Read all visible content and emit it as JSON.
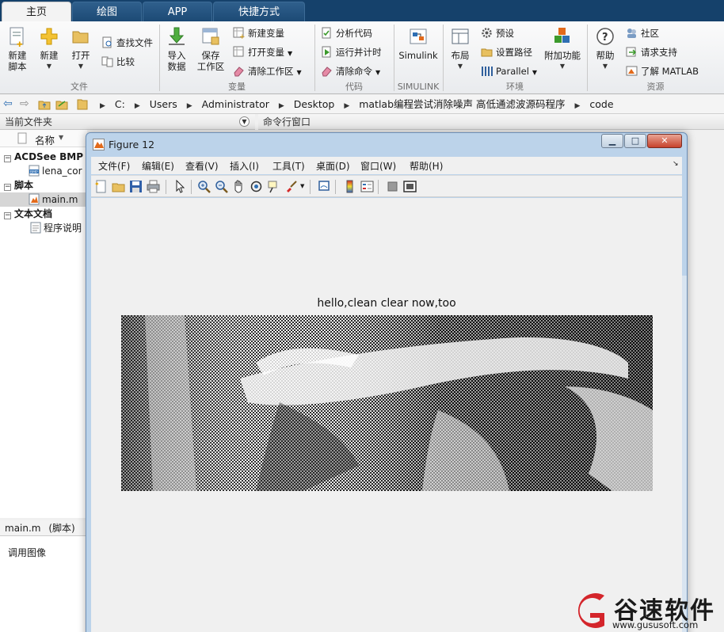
{
  "tabs": [
    {
      "label": "主页",
      "active": true
    },
    {
      "label": "绘图",
      "active": false
    },
    {
      "label": "APP",
      "active": false
    },
    {
      "label": "快捷方式",
      "active": false
    }
  ],
  "ribbon": {
    "file": {
      "new_script": "新建\n脚本",
      "new": "新建",
      "open": "打开",
      "find_files": "查找文件",
      "compare": "比较",
      "group_label": "文件"
    },
    "variable": {
      "import": "导入\n数据",
      "save_ws": "保存\n工作区",
      "new_var": "新建变量",
      "open_var": "打开变量",
      "clear_ws": "清除工作区",
      "group_label": "变量"
    },
    "code": {
      "analyze": "分析代码",
      "run_time": "运行并计时",
      "clear_cmd": "清除命令",
      "group_label": "代码"
    },
    "simulink": {
      "simulink": "Simulink",
      "group_label": "SIMULINK"
    },
    "env": {
      "layout": "布局",
      "prefs": "预设",
      "set_path": "设置路径",
      "parallel": "Parallel",
      "addons": "附加功能",
      "group_label": "环境"
    },
    "resources": {
      "help": "帮助",
      "community": "社区",
      "support": "请求支持",
      "learn": "了解 MATLAB",
      "group_label": "资源"
    }
  },
  "address": {
    "crumbs": [
      "C:",
      "Users",
      "Administrator",
      "Desktop",
      "matlab编程尝试消除噪声 高低通滤波源码程序",
      "code"
    ]
  },
  "current_folder": {
    "title": "当前文件夹",
    "col_name": "名称",
    "groups": [
      {
        "label": "ACDSee BMP 图",
        "items": [
          "lena_cor"
        ]
      },
      {
        "label": "脚本",
        "items": [
          "main.m"
        ]
      },
      {
        "label": "文本文档",
        "items": [
          "程序说明"
        ]
      }
    ]
  },
  "command_window": {
    "title": "命令行窗口"
  },
  "details": {
    "file": "main.m",
    "type": "(脚本)",
    "desc": "调用图像"
  },
  "figure": {
    "title": "Figure 12",
    "menus": [
      "文件(F)",
      "编辑(E)",
      "查看(V)",
      "插入(I)",
      "工具(T)",
      "桌面(D)",
      "窗口(W)",
      "帮助(H)"
    ],
    "plot_title": "hello,clean clear now,too",
    "image": {
      "colormap": "gray",
      "description_visible": false
    }
  },
  "watermark": {
    "brand": "谷速软件",
    "url": "www.gususoft.com",
    "color": "#d4252b"
  },
  "colors": {
    "tabbar": "#15416b",
    "ribbon_bg": "#f3f3f3",
    "figure_frame": "#bcd3ea"
  }
}
